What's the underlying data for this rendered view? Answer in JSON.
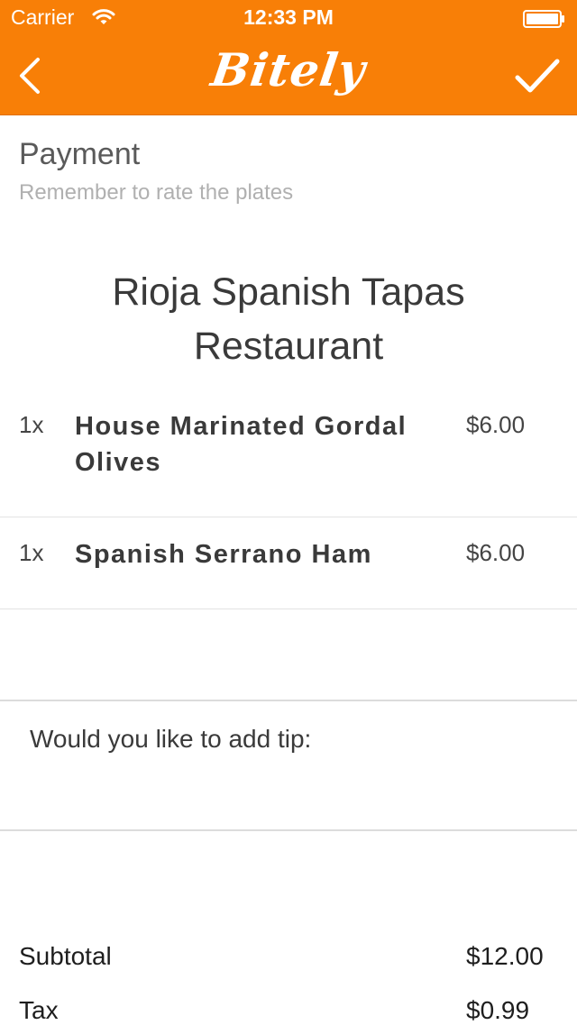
{
  "status_bar": {
    "carrier": "Carrier",
    "time": "12:33 PM"
  },
  "nav": {
    "brand": "Bitely",
    "back_icon": "chevron-left-icon",
    "confirm_icon": "checkmark-icon",
    "accent_color": "#f87f07"
  },
  "page": {
    "title": "Payment",
    "subtitle": "Remember to rate the plates"
  },
  "restaurant": {
    "name": "Rioja Spanish Tapas Restaurant"
  },
  "order_items": [
    {
      "qty": "1x",
      "name": "House Marinated Gordal Olives",
      "price": "$6.00"
    },
    {
      "qty": "1x",
      "name": "Spanish Serrano Ham",
      "price": "$6.00"
    }
  ],
  "tip": {
    "prompt": "Would you like to add tip:"
  },
  "summary": {
    "subtotal_label": "Subtotal",
    "subtotal_value": "$12.00",
    "tax_label": "Tax",
    "tax_value": "$0.99"
  }
}
